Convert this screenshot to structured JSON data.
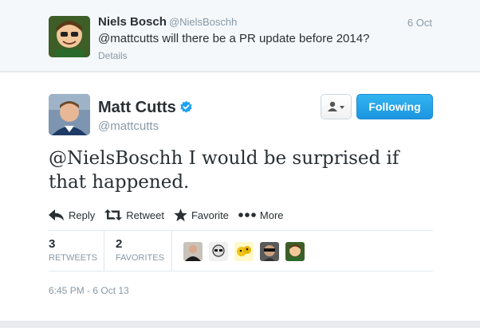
{
  "reply_tweet": {
    "name": "Niels Bosch",
    "handle": "@NielsBoschh",
    "date": "6 Oct",
    "text": "@mattcutts will there be a PR update before 2014?",
    "details_label": "Details"
  },
  "main_tweet": {
    "name": "Matt Cutts",
    "handle": "@mattcutts",
    "text": "@NielsBoschh I would be surprised if that happened.",
    "follow_label": "Following",
    "actions": {
      "reply": "Reply",
      "retweet": "Retweet",
      "favorite": "Favorite",
      "more": "More"
    },
    "stats": {
      "retweets": {
        "count": "3",
        "label": "RETWEETS"
      },
      "favorites": {
        "count": "2",
        "label": "FAVORITES"
      }
    },
    "timestamp": "6:45 PM - 6 Oct 13"
  },
  "colors": {
    "accent": "#1b95e0",
    "verified": "#1da1f2",
    "muted": "#8899a6"
  }
}
